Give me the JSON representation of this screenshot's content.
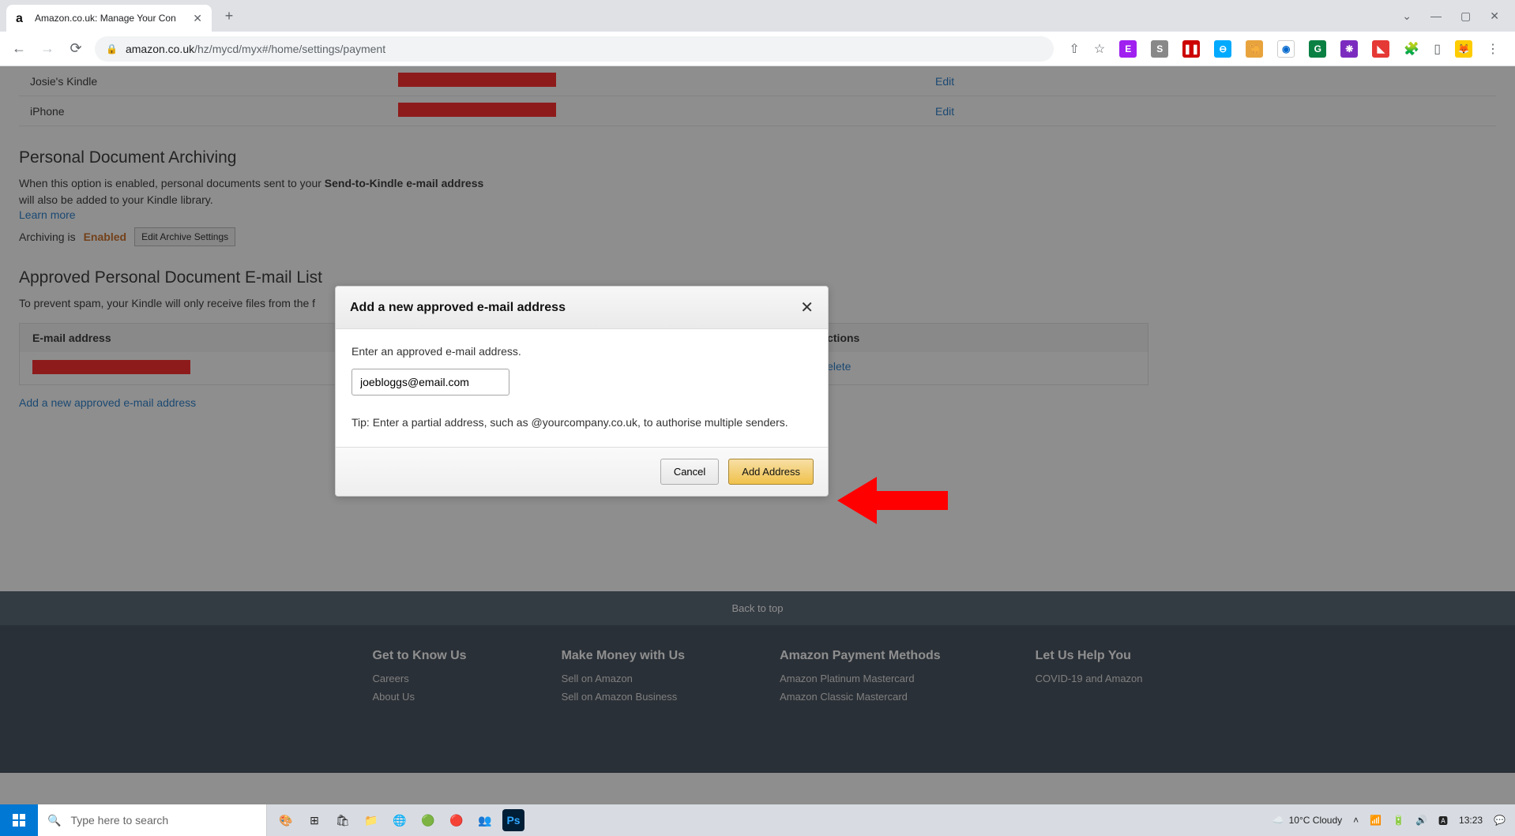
{
  "browser": {
    "tab_title": "Amazon.co.uk: Manage Your Con",
    "url_domain": "amazon.co.uk",
    "url_path": "/hz/mycd/myx#/home/settings/payment"
  },
  "devices": [
    {
      "name": "Josie's Kindle",
      "action": "Edit"
    },
    {
      "name": "iPhone",
      "action": "Edit"
    }
  ],
  "archiving": {
    "heading": "Personal Document Archiving",
    "desc_pre": "When this option is enabled, personal documents sent to your ",
    "desc_bold": "Send-to-Kindle e-mail address",
    "desc_post": " will also be added to your Kindle library.",
    "learn_more": "Learn more",
    "status_label": "Archiving is ",
    "status_value": "Enabled",
    "edit_btn": "Edit Archive Settings"
  },
  "approved": {
    "heading": "Approved Personal Document E-mail List",
    "desc": "To prevent spam, your Kindle will only receive files from the f",
    "col_email": "E-mail address",
    "col_actions": "Actions",
    "row_action": "Delete",
    "add_link": "Add a new approved e-mail address"
  },
  "modal": {
    "title": "Add a new approved e-mail address",
    "prompt": "Enter an approved e-mail address.",
    "input_value": "joebloggs@email.com",
    "tip": "Tip: Enter a partial address, such as @yourcompany.co.uk, to authorise multiple senders.",
    "cancel": "Cancel",
    "add": "Add Address"
  },
  "footer": {
    "back": "Back to top",
    "cols": [
      {
        "title": "Get to Know Us",
        "links": [
          "Careers",
          "About Us"
        ]
      },
      {
        "title": "Make Money with Us",
        "links": [
          "Sell on Amazon",
          "Sell on Amazon Business"
        ]
      },
      {
        "title": "Amazon Payment Methods",
        "links": [
          "Amazon Platinum Mastercard",
          "Amazon Classic Mastercard"
        ]
      },
      {
        "title": "Let Us Help You",
        "links": [
          "COVID-19 and Amazon"
        ]
      }
    ]
  },
  "taskbar": {
    "search_placeholder": "Type here to search",
    "weather": "10°C  Cloudy",
    "time": "13:23"
  }
}
